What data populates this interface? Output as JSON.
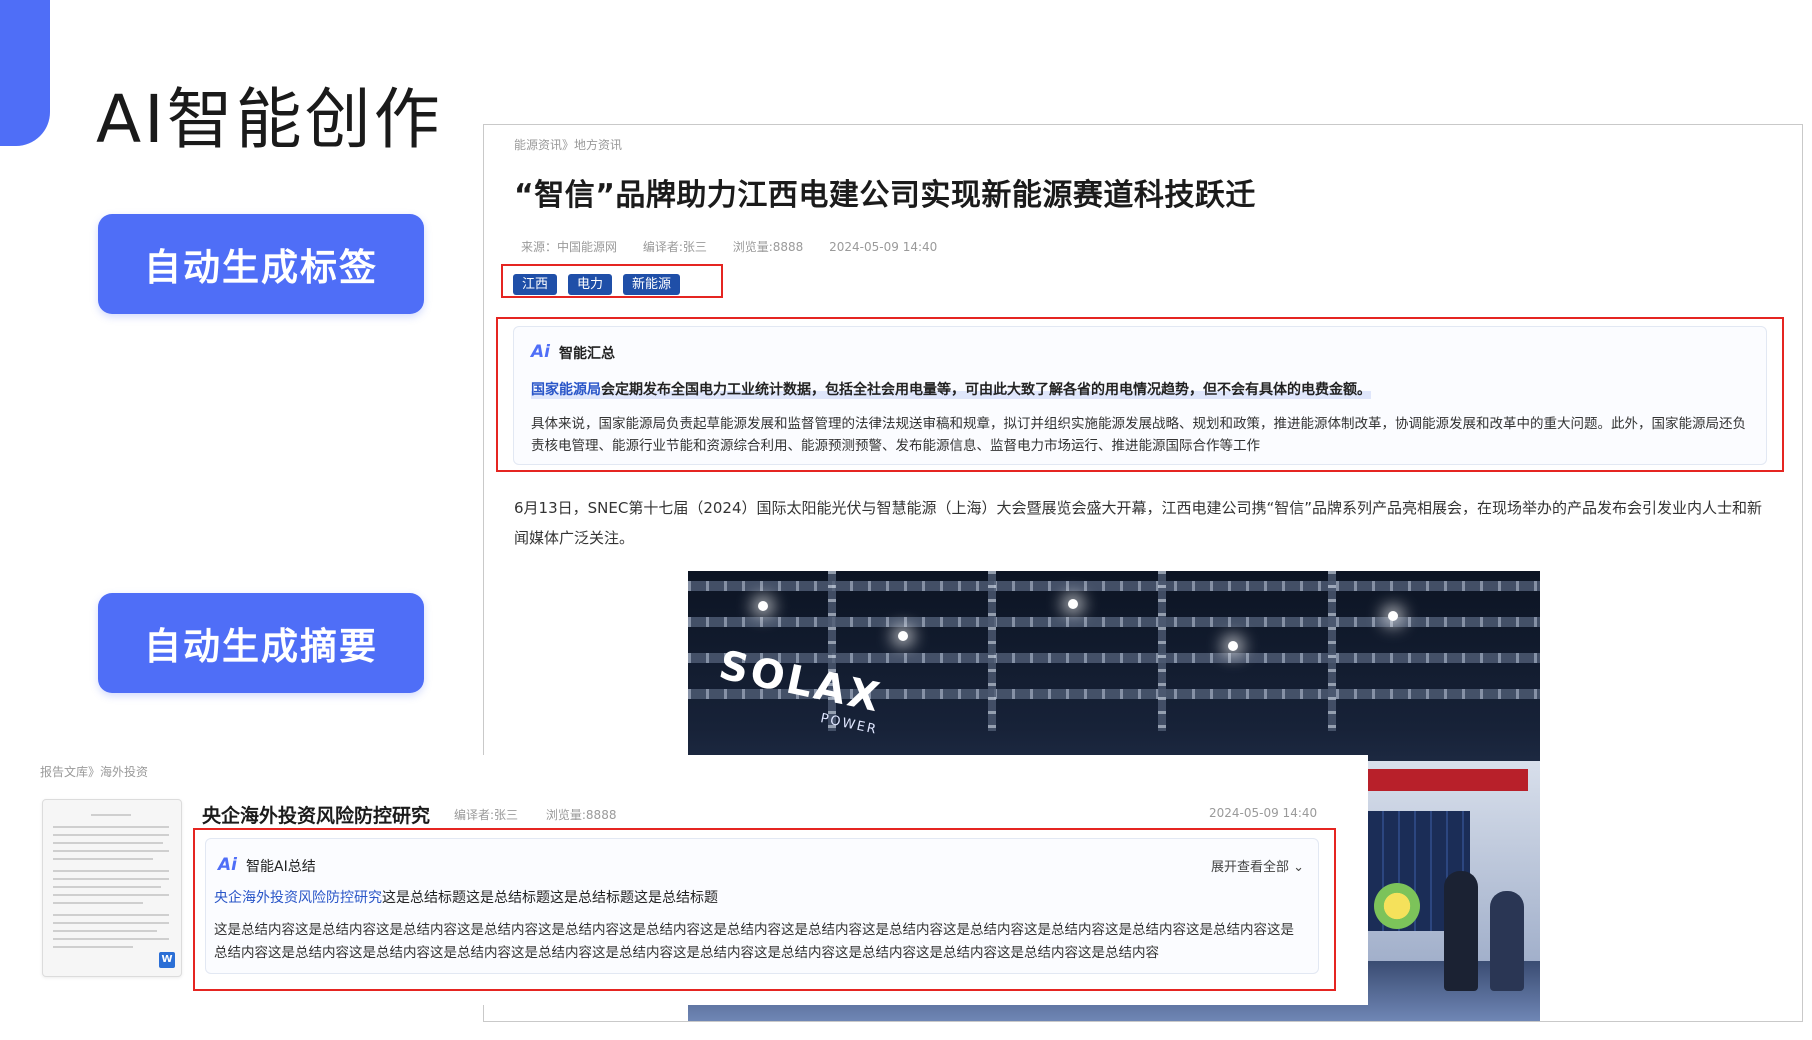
{
  "slide": {
    "title": "AI智能创作",
    "buttons": [
      "自动生成标签",
      "自动生成摘要"
    ],
    "accent_color": "#4F6EF7"
  },
  "article": {
    "breadcrumb": "能源资讯》地方资讯",
    "headline": "“智信”品牌助力江西电建公司实现新能源赛道科技跃迁",
    "meta": {
      "source": "来源：中国能源网",
      "editor": "编译者:张三",
      "views": "浏览量:8888",
      "date": "2024-05-09 14:40"
    },
    "tags": [
      "江西",
      "电力",
      "新能源"
    ],
    "summary": {
      "badge": "Ai",
      "title": "智能汇总",
      "highlight_link": "国家能源局",
      "highlight_rest": "会定期发布全国电力工业统计数据，包括全社会用电量等，可由此大致了解各省的用电情况趋势，但不会有具体的电费金额。",
      "body": "具体来说，国家能源局负责起草能源发展和监督管理的法律法规送审稿和规章，拟订并组织实施能源发展战略、规划和政策，推进能源体制改革，协调能源发展和改革中的重大问题。此外，国家能源局还负责核电管理、能源行业节能和资源综合利用、能源预测预警、发布能源信息、监督电力市场运行、推进能源国际合作等工作"
    },
    "paragraph": "6月13日，SNEC第十七届（2024）国际太阳能光伏与智慧能源（上海）大会暨展览会盛大开幕，江西电建公司携“智信”品牌系列产品亮相展会，在现场举办的产品发布会引发业内人士和新闻媒体广泛关注。",
    "photo_brand": "SOLAX",
    "photo_brand_sub": "POWER"
  },
  "report": {
    "breadcrumb": "报告文库》海外投资",
    "title": "央企海外投资风险防控研究",
    "editor": "编译者:张三",
    "views": "浏览量:8888",
    "date": "2024-05-09 14:40",
    "doc_badge": "W",
    "summary": {
      "badge": "Ai",
      "title": "智能AI总结",
      "expand": "展开查看全部",
      "heading_link": "央企海外投资风险防控研究",
      "heading_rest": "这是总结标题这是总结标题这是总结标题这是总结标题",
      "body": "这是总结内容这是总结内容这是总结内容这是总结内容这是总结内容这是总结内容这是总结内容这是总结内容这是总结内容这是总结内容这是总结内容这是总结内容这是总结内容这是总结内容这是总结内容这是总结内容这是总结内容这是总结内容这是总结内容这是总结内容这是总结内容这是总结内容这是总结内容这是总结内容这是总结内容"
    }
  }
}
